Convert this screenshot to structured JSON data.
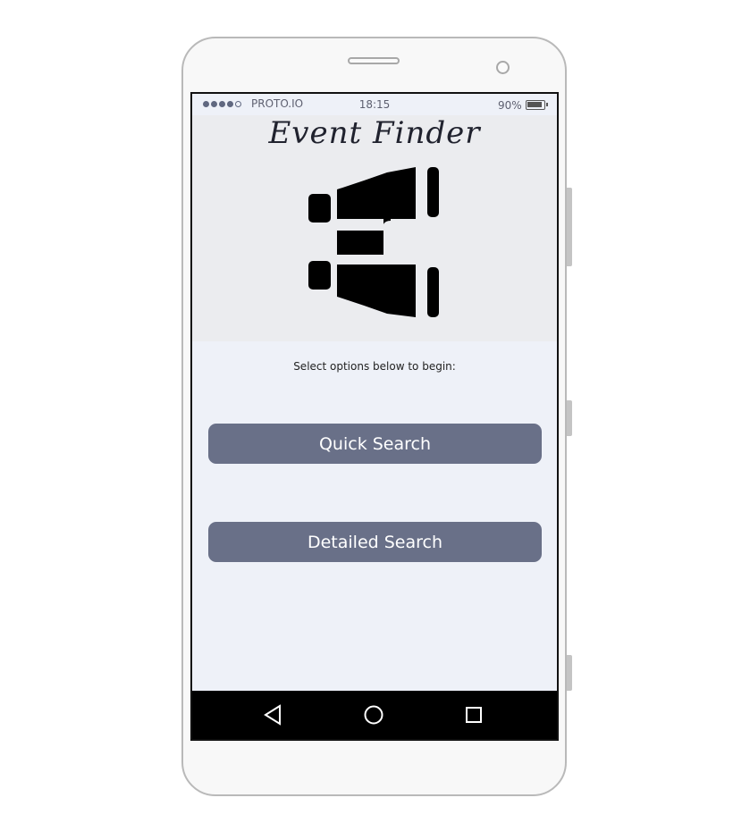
{
  "status_bar": {
    "carrier": "PROTO.IO",
    "time": "18:15",
    "battery": "90%",
    "signal_dots": [
      true,
      true,
      true,
      true,
      false
    ]
  },
  "app": {
    "title": "Event Finder",
    "logo_icon": "binoculars-icon",
    "intro": "Select options below to begin:"
  },
  "buttons": {
    "quick_search": "Quick Search",
    "detailed_search": "Detailed Search"
  },
  "nav": {
    "back_icon": "triangle-back-icon",
    "home_icon": "circle-home-icon",
    "recents_icon": "square-recents-icon"
  },
  "colors": {
    "button": "#697088",
    "screen_bg": "#eef1f8",
    "hero_bg": "#ebecef",
    "nav_bar": "#000000"
  }
}
